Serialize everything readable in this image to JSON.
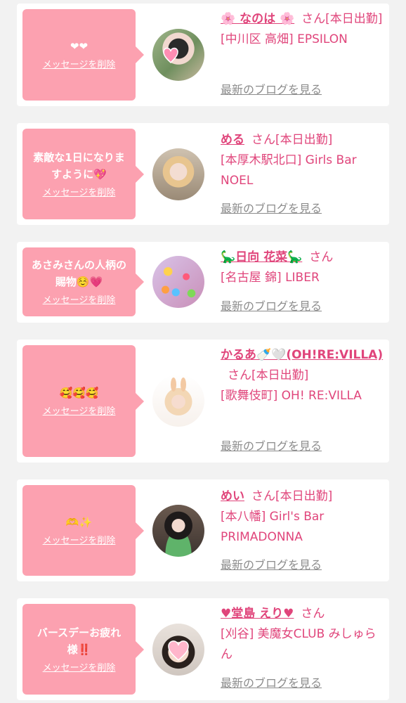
{
  "cards": [
    {
      "name": "🌸 なのは 🌸",
      "honorific": "さん",
      "status": "[本日出勤]",
      "location": "[中川区 高畑] EPSILON",
      "message": "❤❤",
      "delete_label": "メッセージを削除",
      "blog_label": "最新のブログを見る",
      "avatar_icon": "profile-photo-icon"
    },
    {
      "name": "める",
      "honorific": "さん",
      "status": "[本日出勤]",
      "location": "[本厚木駅北口] Girls Bar NOEL",
      "message": "素敵な1日になりますように💖",
      "delete_label": "メッセージを削除",
      "blog_label": "最新のブログを見る",
      "avatar_icon": "profile-photo-icon"
    },
    {
      "name": "🦕日向 花菜🦕",
      "honorific": "さん",
      "status": "",
      "location": "[名古屋 錦] LIBER",
      "message": "あさみさんの人柄の賜物☺️💗",
      "delete_label": "メッセージを削除",
      "blog_label": "最新のブログを見る",
      "avatar_icon": "profile-photo-icon"
    },
    {
      "name": "かるあ🍼🤍(OH!RE:VILLA)",
      "honorific": "さん",
      "status": "[本日出勤]",
      "location": "[歌舞伎町] OH! RE:VILLA",
      "message": "🥰🥰🥰",
      "delete_label": "メッセージを削除",
      "blog_label": "最新のブログを見る",
      "avatar_icon": "profile-photo-icon"
    },
    {
      "name": "めい",
      "honorific": "さん",
      "status": "[本日出勤]",
      "location": "[本八幡] Girl's Bar PRIMADONNA",
      "message": "🫶✨",
      "delete_label": "メッセージを削除",
      "blog_label": "最新のブログを見る",
      "avatar_icon": "profile-photo-icon"
    },
    {
      "name": "♥堂島 えり♥",
      "honorific": "さん",
      "status": "",
      "location": "[刈谷] 美魔女CLUB みしゅらん",
      "message": "バースデーお疲れ様‼️",
      "delete_label": "メッセージを削除",
      "blog_label": "最新のブログを見る",
      "avatar_icon": "profile-photo-icon"
    }
  ],
  "colors": {
    "bubble": "#fca1b0",
    "accent": "#e0457b",
    "muted": "#8c8c8c",
    "background": "#f2f2f2"
  }
}
